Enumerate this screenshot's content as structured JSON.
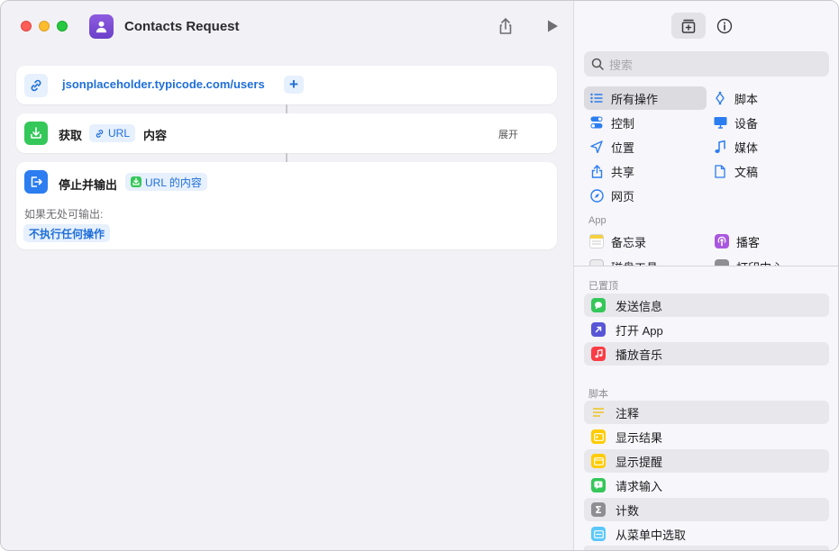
{
  "window": {
    "title": "Contacts Request"
  },
  "toolbar": {
    "share_icon": "share-icon",
    "run_icon": "play-icon"
  },
  "actions": {
    "url": {
      "value": "jsonplaceholder.typicode.com/users",
      "add_symbol": "+"
    },
    "get": {
      "verb": "获取",
      "param": "URL",
      "noun": "内容",
      "expand": "展开"
    },
    "stop": {
      "label": "停止并输出",
      "param": "URL 的内容",
      "fallback_label": "如果无处可输出:",
      "fallback_value": "不执行任何操作"
    }
  },
  "sidebar": {
    "search_placeholder": "搜索",
    "categories": [
      {
        "label": "所有操作",
        "icon": "list-icon"
      },
      {
        "label": "脚本",
        "icon": "script-icon"
      },
      {
        "label": "控制",
        "icon": "toggle-icon"
      },
      {
        "label": "设备",
        "icon": "display-icon"
      },
      {
        "label": "位置",
        "icon": "location-icon"
      },
      {
        "label": "媒体",
        "icon": "music-note-icon"
      },
      {
        "label": "共享",
        "icon": "share-icon"
      },
      {
        "label": "文稿",
        "icon": "document-icon"
      },
      {
        "label": "网页",
        "icon": "compass-icon"
      }
    ],
    "app_header": "App",
    "apps": [
      {
        "label": "备忘录",
        "icon": "notes-icon"
      },
      {
        "label": "播客",
        "icon": "podcasts-icon"
      },
      {
        "label": "磁盘工具",
        "icon": "disk-utility-icon"
      },
      {
        "label": "打印中心",
        "icon": "printer-icon"
      }
    ],
    "pinned_header": "已置顶",
    "pinned": [
      {
        "label": "发送信息",
        "color": "#34c759"
      },
      {
        "label": "打开 App",
        "color": "#5856d6"
      },
      {
        "label": "播放音乐",
        "color": "#fc3c44"
      }
    ],
    "scripting_header": "脚本",
    "scripting": [
      {
        "label": "注释",
        "color": "#f5d142"
      },
      {
        "label": "显示结果",
        "color": "#ffcc00"
      },
      {
        "label": "显示提醒",
        "color": "#ffcc00"
      },
      {
        "label": "请求输入",
        "color": "#34c759"
      },
      {
        "label": "计数",
        "color": "#8e8e93"
      },
      {
        "label": "从菜单中选取",
        "color": "#5ac8fa"
      }
    ]
  }
}
